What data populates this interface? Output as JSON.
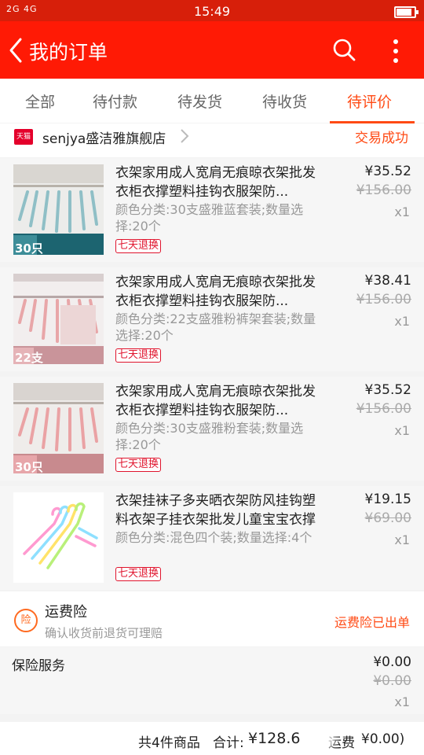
{
  "status_bar": {
    "signal": "2G 4G",
    "time": "15:49",
    "battery_level": 0.8
  },
  "app_bar": {
    "title": "我的订单"
  },
  "tabs": [
    {
      "label": "全部",
      "active": false
    },
    {
      "label": "待付款",
      "active": false
    },
    {
      "label": "待发货",
      "active": false
    },
    {
      "label": "待收货",
      "active": false
    },
    {
      "label": "待评价",
      "active": true
    }
  ],
  "shop": {
    "badge": "天猫",
    "name": "senjya盛洁雅旗舰店",
    "status": "交易成功"
  },
  "items": [
    {
      "title": "衣架家用成人宽肩无痕晾衣架批发衣柜衣撑塑料挂钩衣服架防...",
      "spec": "颜色分类:30支盛雅蓝套装;数量选择:20个",
      "badge": "七天退换",
      "price": "¥35.52",
      "original_price": "¥156.00",
      "qty": "x1",
      "thumb_tag": "30只",
      "hanger_color": "#8fbfc6"
    },
    {
      "title": "衣架家用成人宽肩无痕晾衣架批发衣柜衣撑塑料挂钩衣服架防...",
      "spec": "颜色分类:22支盛雅粉裤架套装;数量选择:20个",
      "badge": "七天退换",
      "price": "¥38.41",
      "original_price": "¥156.00",
      "qty": "x1",
      "thumb_tag": "22支",
      "hanger_color": "#e8a6a8"
    },
    {
      "title": "衣架家用成人宽肩无痕晾衣架批发衣柜衣撑塑料挂钩衣服架防...",
      "spec": "颜色分类:30支盛雅粉套装;数量选择:20个",
      "badge": "七天退换",
      "price": "¥35.52",
      "original_price": "¥156.00",
      "qty": "x1",
      "thumb_tag": "30只",
      "hanger_color": "#eaa2a4"
    },
    {
      "title": "衣架挂袜子多夹晒衣架防风挂钩塑料衣架子挂衣架批发儿童宝宝衣撑",
      "spec": "颜色分类:混色四个装;数量选择:4个",
      "badge": "七天退换",
      "price": "¥19.15",
      "original_price": "¥69.00",
      "qty": "x1",
      "thumb_tag": "",
      "hanger_color": "#ff8fc8"
    }
  ],
  "insurance": {
    "icon_text": "险",
    "title": "运费险",
    "subtitle": "确认收货前退货可理赔",
    "status": "运费险已出单"
  },
  "service": {
    "label": "保险服务",
    "price": "¥0.00",
    "original_price": "¥0.00",
    "qty": "x1"
  },
  "summary": {
    "count": "共4件商品",
    "total_label": "合计:",
    "total": "¥128.6",
    "freight_label": "运费",
    "freight": "¥0.00)"
  },
  "colors": {
    "brand_red": "#ff1a05",
    "status_red": "#d71f0a",
    "accent_orange": "#ff4a14"
  }
}
